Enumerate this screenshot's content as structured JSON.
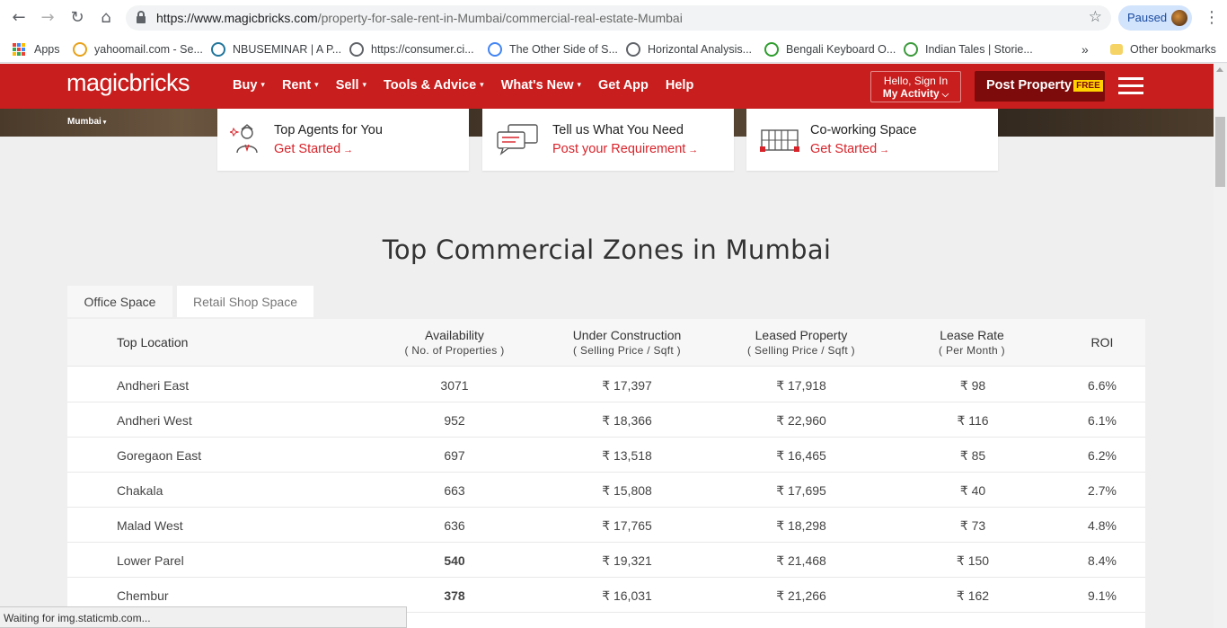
{
  "browser": {
    "url_host": "https://www.magicbricks.com",
    "url_path": "/property-for-sale-rent-in-Mumbai/commercial-real-estate-Mumbai",
    "profile_status": "Paused",
    "bookmarks": [
      {
        "label": "Apps",
        "icon": "apps-grid-icon"
      },
      {
        "label": "yahoomail.com - Se...",
        "icon": "yahoo-icon",
        "color": "#e8a21a"
      },
      {
        "label": "NBUSEMINAR | A P...",
        "icon": "wordpress-icon",
        "color": "#21759b"
      },
      {
        "label": "https://consumer.ci...",
        "icon": "globe-icon",
        "color": "#5f6368"
      },
      {
        "label": "The Other Side of S...",
        "icon": "google-icon",
        "color": "#4285f4"
      },
      {
        "label": "Horizontal Analysis...",
        "icon": "globe-icon",
        "color": "#5f6368"
      },
      {
        "label": "Bengali Keyboard O...",
        "icon": "l-letter-icon",
        "color": "#2e9e2e"
      },
      {
        "label": "Indian Tales | Storie...",
        "icon": "leaf-icon",
        "color": "#3c9a3c"
      }
    ],
    "more_bookmarks": "»",
    "other_bookmarks": "Other bookmarks"
  },
  "header": {
    "logo": "magicbricks",
    "menu": [
      {
        "label": "Buy",
        "caret": true
      },
      {
        "label": "Rent",
        "caret": true
      },
      {
        "label": "Sell",
        "caret": true
      },
      {
        "label": "Tools & Advice",
        "caret": true
      },
      {
        "label": "What's New",
        "caret": true
      },
      {
        "label": "Get App",
        "caret": false
      },
      {
        "label": "Help",
        "caret": false
      }
    ],
    "signin_line1": "Hello, Sign In",
    "signin_line2": "My Activity",
    "post_property": "Post Property",
    "free_tag": "FREE"
  },
  "banner": {
    "city": "Mumbai",
    "cards": [
      {
        "title": "Top Agents for You",
        "link": "Get Started",
        "icon": "agent-icon"
      },
      {
        "title": "Tell us What You Need",
        "link": "Post your Requirement",
        "icon": "chat-bubbles-icon"
      },
      {
        "title": "Co-working Space",
        "link": "Get Started",
        "icon": "coworking-icon"
      }
    ]
  },
  "section": {
    "title": "Top Commercial Zones in Mumbai",
    "tabs": [
      {
        "label": "Office Space",
        "active": true
      },
      {
        "label": "Retail Shop Space",
        "active": false
      }
    ]
  },
  "table": {
    "columns": [
      {
        "label": "Top Location",
        "sub": ""
      },
      {
        "label": "Availability",
        "sub": "( No. of Properties )"
      },
      {
        "label": "Under Construction",
        "sub": "( Selling Price / Sqft )"
      },
      {
        "label": "Leased Property",
        "sub": "( Selling Price / Sqft )"
      },
      {
        "label": "Lease Rate",
        "sub": "( Per Month )"
      },
      {
        "label": "ROI",
        "sub": ""
      }
    ],
    "rows": [
      {
        "location": "Andheri East",
        "availability": "3071",
        "under_construction": "₹ 17,397",
        "leased": "₹ 17,918",
        "lease_rate": "₹ 98",
        "roi": "6.6%",
        "bold": false
      },
      {
        "location": "Andheri West",
        "availability": "952",
        "under_construction": "₹ 18,366",
        "leased": "₹ 22,960",
        "lease_rate": "₹ 116",
        "roi": "6.1%",
        "bold": false
      },
      {
        "location": "Goregaon East",
        "availability": "697",
        "under_construction": "₹ 13,518",
        "leased": "₹ 16,465",
        "lease_rate": "₹ 85",
        "roi": "6.2%",
        "bold": false
      },
      {
        "location": "Chakala",
        "availability": "663",
        "under_construction": "₹ 15,808",
        "leased": "₹ 17,695",
        "lease_rate": "₹ 40",
        "roi": "2.7%",
        "bold": false
      },
      {
        "location": "Malad West",
        "availability": "636",
        "under_construction": "₹ 17,765",
        "leased": "₹ 18,298",
        "lease_rate": "₹ 73",
        "roi": "4.8%",
        "bold": false
      },
      {
        "location": "Lower Parel",
        "availability": "540",
        "under_construction": "₹ 19,321",
        "leased": "₹ 21,468",
        "lease_rate": "₹ 150",
        "roi": "8.4%",
        "bold": true
      },
      {
        "location": "Chembur",
        "availability": "378",
        "under_construction": "₹ 16,031",
        "leased": "₹ 21,266",
        "lease_rate": "₹ 162",
        "roi": "9.1%",
        "bold": true
      }
    ]
  },
  "status": "Waiting for img.staticmb.com...",
  "colors": {
    "brand_red": "#c81e1e",
    "post_dark_red": "#7e0b0b",
    "link_red": "#d8232a",
    "free_yellow": "#ffd200"
  }
}
